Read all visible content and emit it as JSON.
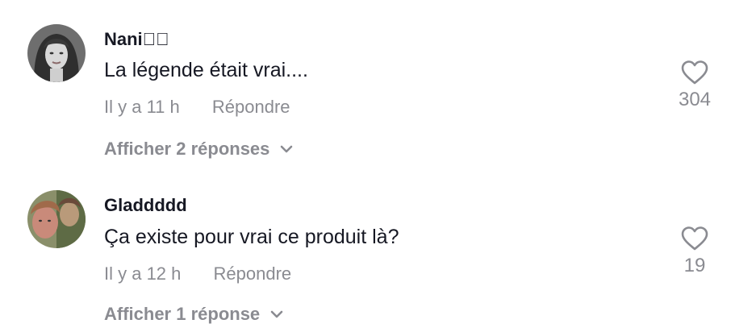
{
  "comments": [
    {
      "username": "Nani\u0000\u0000",
      "text": "La légende était vrai....",
      "time": "Il y a 11 h",
      "reply_label": "Répondre",
      "view_replies": "Afficher 2 réponses",
      "likes": "304"
    },
    {
      "username": "Gladdddd",
      "text": "Ça existe pour vrai ce produit là?",
      "time": "Il y a 12 h",
      "reply_label": "Répondre",
      "view_replies": "Afficher 1 réponse",
      "likes": "19"
    }
  ],
  "icons": {
    "like": "heart-outline-icon",
    "expand": "chevron-down-icon"
  },
  "colors": {
    "text": "#161823",
    "muted": "#8a8b91",
    "background": "#ffffff"
  }
}
